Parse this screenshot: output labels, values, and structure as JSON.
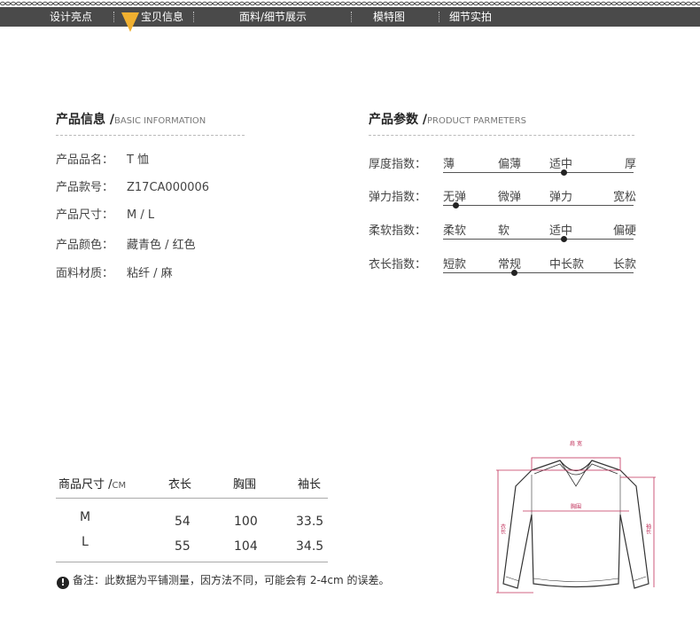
{
  "nav": {
    "items": [
      "设计亮点",
      "宝贝信息",
      "面料/细节展示",
      "模特图",
      "细节实拍"
    ],
    "active_index": 1,
    "colors": {
      "bar": "#4a4a4a",
      "active_arrow": "#f0b030"
    }
  },
  "product_info": {
    "title": "产品信息 /",
    "subtitle": "BASIC INFORMATION",
    "rows": [
      {
        "label": "产品品名：",
        "value": "T 恤"
      },
      {
        "label": "产品款号：",
        "value": "Z17CA000006"
      },
      {
        "label": "产品尺寸：",
        "value": "M / L"
      },
      {
        "label": "产品颜色：",
        "value": "藏青色 / 红色"
      },
      {
        "label": "面料材质：",
        "value": "粘纤 / 麻"
      }
    ]
  },
  "product_params": {
    "title": "产品参数 /",
    "subtitle": "PRODUCT PARMETERS",
    "rows": [
      {
        "label": "厚度指数：",
        "options": [
          "薄",
          "偏薄",
          "适中",
          "厚"
        ],
        "selected_index": 2
      },
      {
        "label": "弹力指数：",
        "options": [
          "无弹",
          "微弹",
          "弹力",
          "宽松"
        ],
        "selected_index": 0
      },
      {
        "label": "柔软指数：",
        "options": [
          "柔软",
          "软",
          "适中",
          "偏硬"
        ],
        "selected_index": 2
      },
      {
        "label": "衣长指数：",
        "options": [
          "短款",
          "常规",
          "中长款",
          "长款"
        ],
        "selected_index": 1
      }
    ]
  },
  "size_table": {
    "title": "商品尺寸 /",
    "unit": "CM",
    "headers": [
      "衣长",
      "胸围",
      "袖长"
    ],
    "rows": [
      {
        "size": "M",
        "values": [
          "54",
          "100",
          "33.5"
        ]
      },
      {
        "size": "L",
        "values": [
          "55",
          "104",
          "34.5"
        ]
      }
    ]
  },
  "note": {
    "icon": "!",
    "text": "备注：此数据为平铺测量，因方法不同，可能会有 2-4cm 的误差。"
  },
  "diagram": {
    "shoulder_label": "肩 宽",
    "chest_label": "胸围",
    "length_label": "衣长",
    "sleeve_label": "袖长",
    "accent_color": "#c0305a"
  }
}
